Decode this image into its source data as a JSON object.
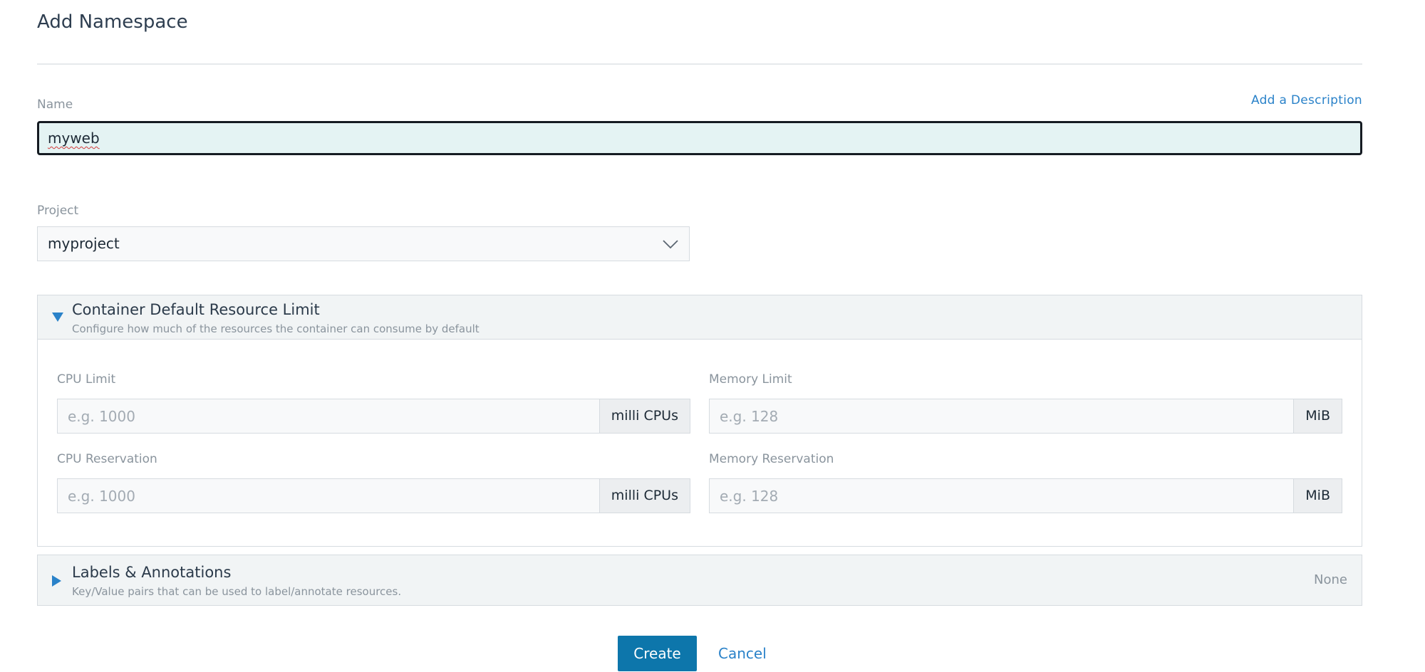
{
  "page": {
    "title": "Add Namespace"
  },
  "name_field": {
    "label": "Name",
    "value": "myweb",
    "add_description_link": "Add a Description"
  },
  "project_field": {
    "label": "Project",
    "selected": "myproject",
    "icon": "chevron-down-icon"
  },
  "resource_limit": {
    "title": "Container Default Resource Limit",
    "subtitle": "Configure how much of the resources the container can consume by default",
    "expanded": true,
    "icon": "triangle-down-icon",
    "cpu_limit": {
      "label": "CPU Limit",
      "placeholder": "e.g. 1000",
      "unit": "milli CPUs"
    },
    "memory_limit": {
      "label": "Memory Limit",
      "placeholder": "e.g. 128",
      "unit": "MiB"
    },
    "cpu_reservation": {
      "label": "CPU Reservation",
      "placeholder": "e.g. 1000",
      "unit": "milli CPUs"
    },
    "memory_reservation": {
      "label": "Memory Reservation",
      "placeholder": "e.g. 128",
      "unit": "MiB"
    }
  },
  "labels_section": {
    "title": "Labels & Annotations",
    "subtitle": "Key/Value pairs that can be used to label/annotate resources.",
    "status": "None",
    "expanded": false,
    "icon": "triangle-right-icon"
  },
  "actions": {
    "create_label": "Create",
    "cancel_label": "Cancel"
  },
  "colors": {
    "primary_button": "#0d76ab",
    "link": "#2a82c9",
    "focused_input_bg": "#e4f3f3",
    "section_header_bg": "#f1f4f5"
  }
}
